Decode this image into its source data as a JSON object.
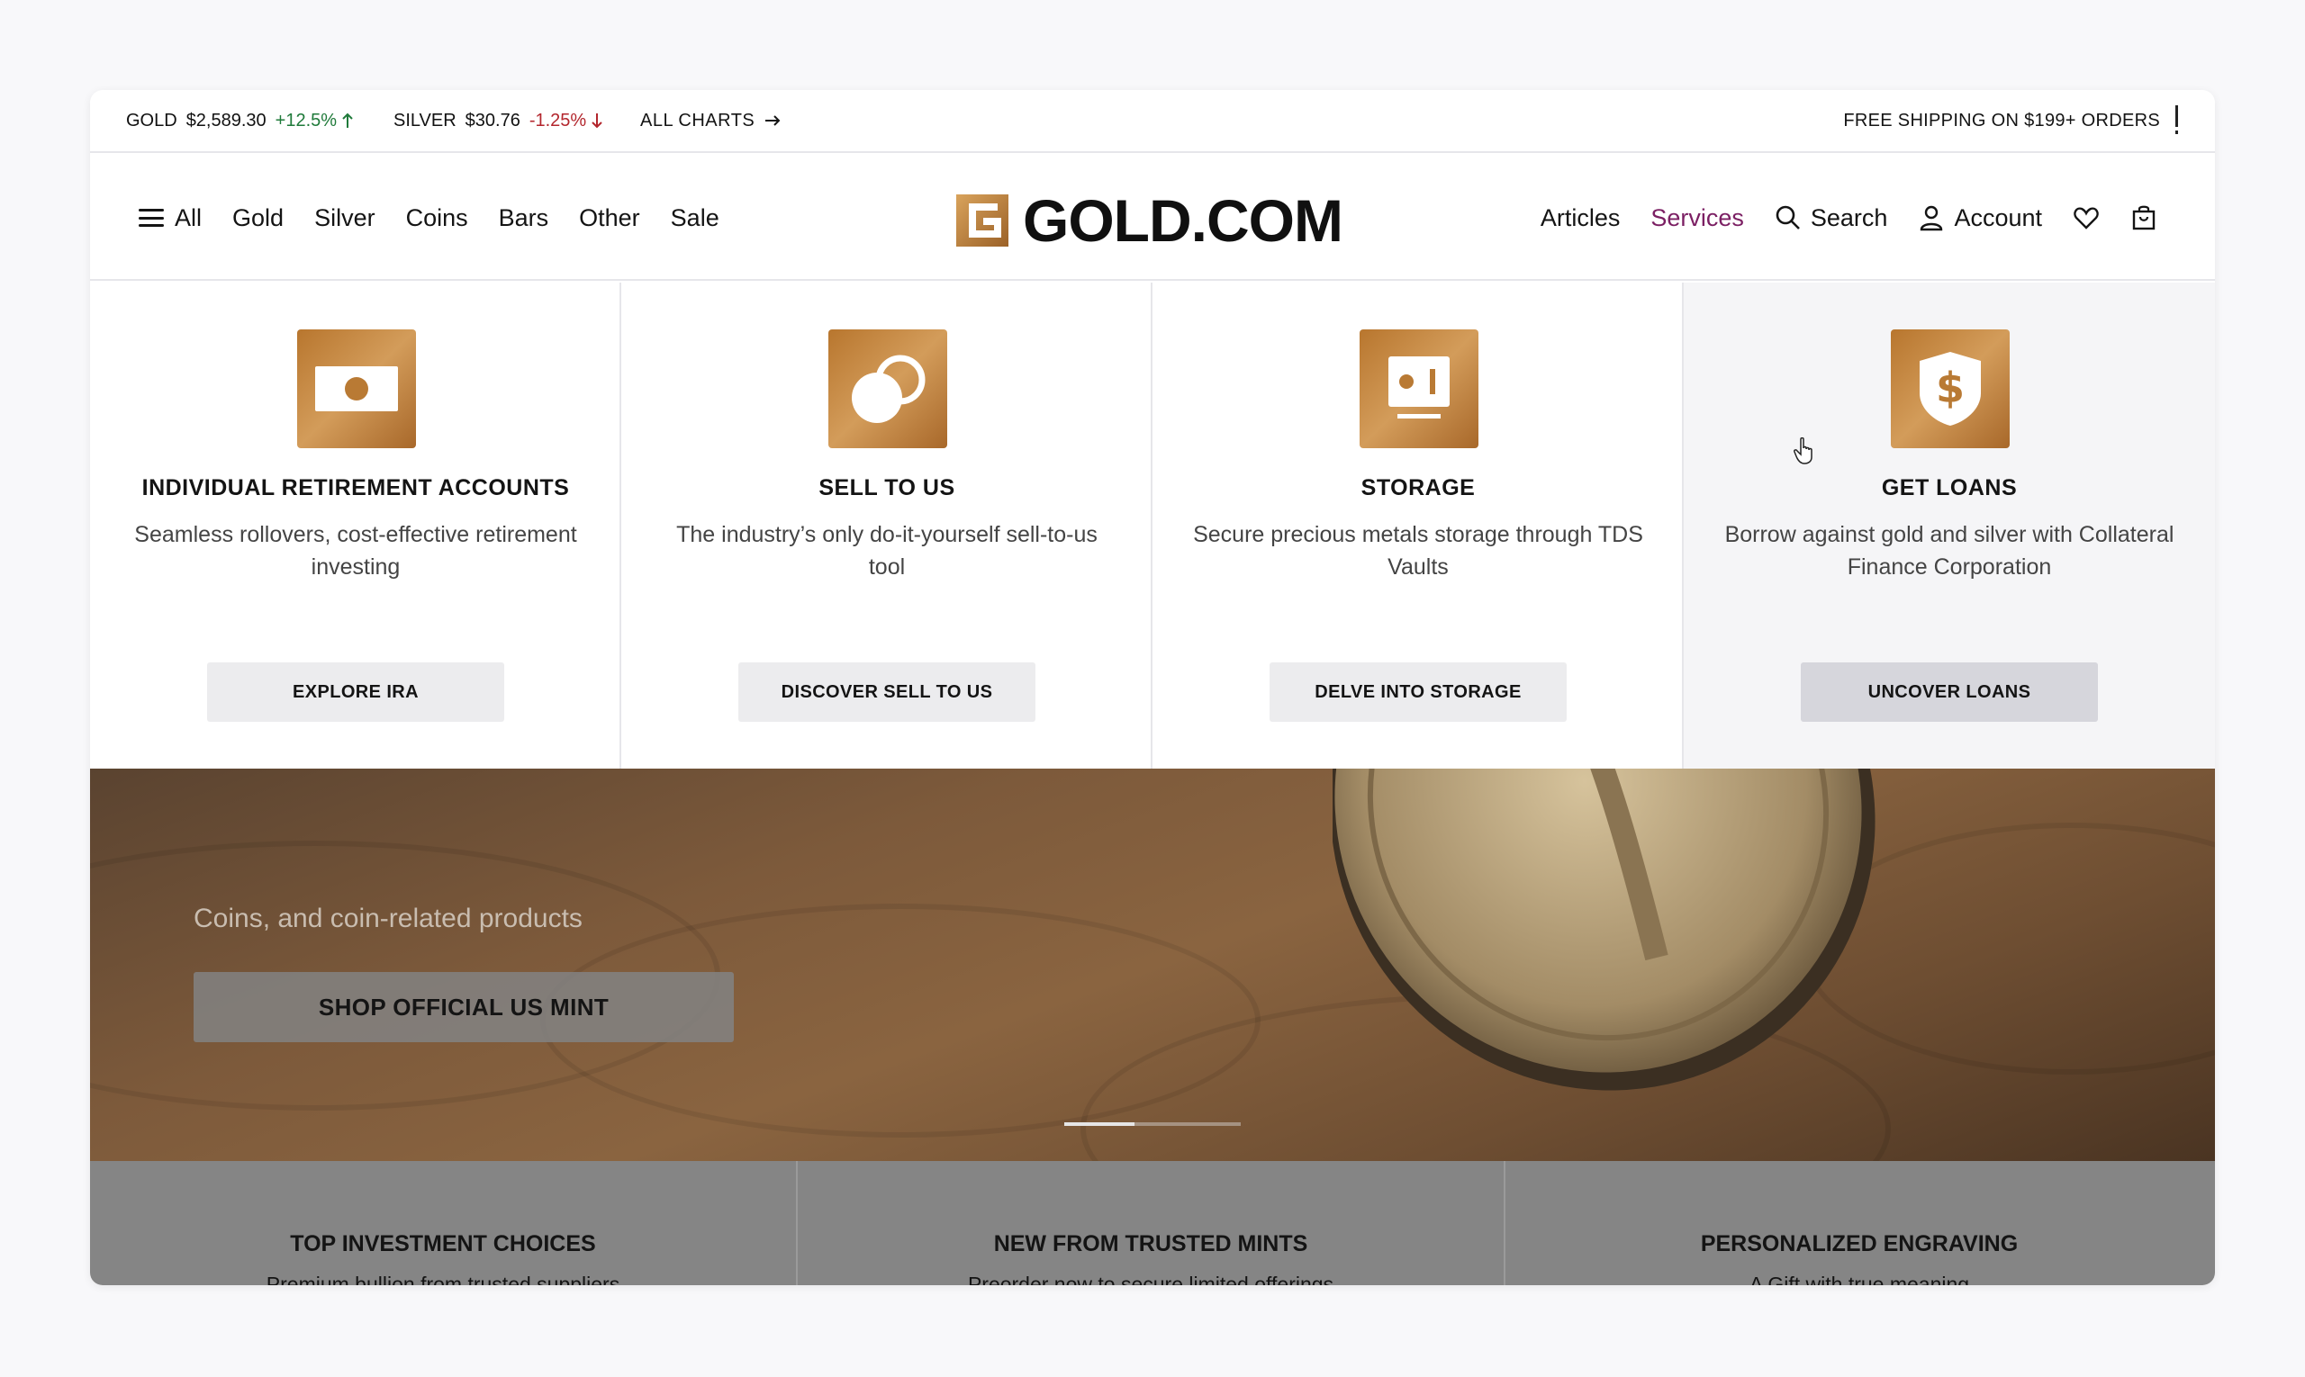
{
  "ticker": {
    "gold": {
      "label": "GOLD",
      "price": "$2,589.30",
      "change": "+12.5%"
    },
    "silver": {
      "label": "SILVER",
      "price": "$30.76",
      "change": "-1.25%"
    },
    "all_charts": "ALL CHARTS",
    "shipping": "FREE SHIPPING ON $199+ ORDERS"
  },
  "nav": {
    "left": [
      "All",
      "Gold",
      "Silver",
      "Coins",
      "Bars",
      "Other",
      "Sale"
    ],
    "logo": "GOLD.COM",
    "articles": "Articles",
    "services": "Services",
    "search": "Search",
    "account": "Account"
  },
  "services": [
    {
      "title": "INDIVIDUAL RETIREMENT ACCOUNTS",
      "desc": "Seamless rollovers, cost-effective retirement investing",
      "button": "EXPLORE IRA",
      "icon": "cash-icon"
    },
    {
      "title": "SELL TO US",
      "desc": "The industry’s only do-it-yourself sell-to-us tool",
      "button": "DISCOVER SELL TO US",
      "icon": "coins-icon"
    },
    {
      "title": "STORAGE",
      "desc": "Secure precious metals storage through TDS Vaults",
      "button": "DELVE INTO STORAGE",
      "icon": "vault-icon"
    },
    {
      "title": "GET LOANS",
      "desc": "Borrow against gold and silver with Collateral Finance Corporation",
      "button": "UNCOVER LOANS",
      "icon": "dollar-shield-icon"
    }
  ],
  "hero": {
    "subtitle": "Coins, and coin-related products",
    "cta": "SHOP OFFICIAL US MINT",
    "slide_active": 1,
    "slide_count": 3
  },
  "features": [
    {
      "title": "TOP INVESTMENT CHOICES",
      "sub": "Premium bullion from trusted suppliers"
    },
    {
      "title": "NEW FROM TRUSTED MINTS",
      "sub": "Preorder now to secure limited offerings"
    },
    {
      "title": "PERSONALIZED ENGRAVING",
      "sub": "A Gift with true meaning"
    }
  ],
  "colors": {
    "accent_services": "#7b1f63",
    "price_up": "#1f7a3a",
    "price_down": "#b3262d",
    "gold_tile": "#c0843f"
  }
}
